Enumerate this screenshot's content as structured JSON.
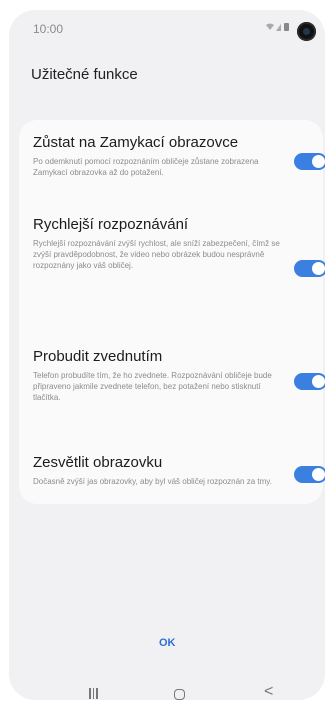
{
  "status_bar": {
    "time": "10:00"
  },
  "page": {
    "title": "Užitečné funkce"
  },
  "settings": [
    {
      "title": "Zůstat na Zamykací obrazovce",
      "description": "Po odemknutí pomocí rozpoznáním obličeje zůstane zobrazena Zamykací obrazovka až do potažení.",
      "enabled": true
    },
    {
      "title": "Rychlejší rozpoznávání",
      "description": "Rychlejší rozpoznávání zvýší rychlost, ale sníží zabezpečení, čímž se zvýší pravděpodobnost, že video nebo obrázek budou nesprávně rozpoznány jako váš obličej.",
      "enabled": true
    },
    {
      "title": "Probudit zvednutím",
      "description": "Telefon probudíte tím, že ho zvednete. Rozpoznávání obličeje bude připraveno jakmile zvednete telefon, bez potažení nebo stisknutí tlačítka.",
      "enabled": true
    },
    {
      "title": "Zesvětlit obrazovku",
      "description": "Dočasně zvýší jas obrazovky, aby byl váš obličej rozpoznán za tmy.",
      "enabled": true
    }
  ],
  "footer": {
    "ok_label": "OK"
  },
  "navbar": {
    "recents": "|||",
    "back": "<"
  },
  "colors": {
    "accent": "#3b7fe0",
    "ok_text": "#2c6fd6",
    "background": "#f1f1f3",
    "card": "#fafafa"
  },
  "icons": {
    "recents": "recents-icon",
    "home": "home-icon",
    "back": "back-icon",
    "camera": "front-camera-icon",
    "status": "wifi-signal-battery-icon"
  }
}
